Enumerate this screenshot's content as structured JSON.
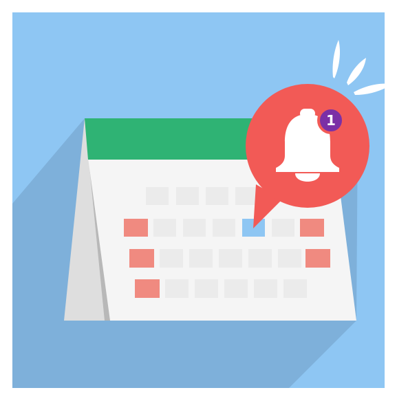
{
  "illustration": {
    "subject": "calendar-with-notification-bell",
    "notification_count": "1",
    "colors": {
      "background": "#8ec6f3",
      "shadow": "#7eb0da",
      "calendar_header": "#2fb374",
      "calendar_page": "#f5f5f5",
      "calendar_back": "#dcdcdc",
      "calendar_side": "#bdbdbd",
      "day_cell": "#ebebeb",
      "weekend_cell": "#f08a80",
      "highlight_cell": "#8ec6f3",
      "bubble": "#f25a56",
      "bell": "#ffffff",
      "badge": "#7b2fa6",
      "sparkles": "#ffffff"
    }
  }
}
